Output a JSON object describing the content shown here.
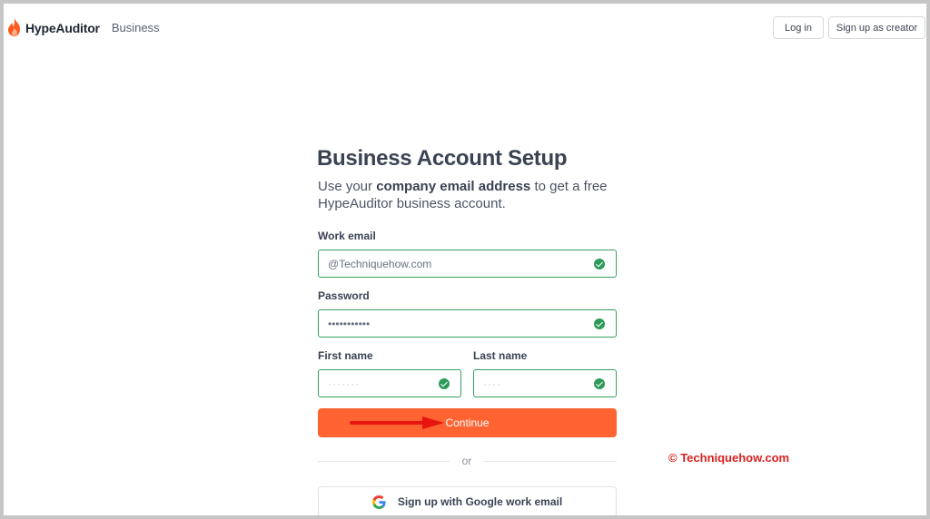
{
  "header": {
    "brand": "HypeAuditor",
    "section": "Business",
    "login_label": "Log in",
    "creator_label": "Sign up as creator"
  },
  "form": {
    "title": "Business Account Setup",
    "intro_before": "Use your ",
    "intro_bold": "company email address",
    "intro_after": " to get a free HypeAuditor business account.",
    "email_label": "Work email",
    "email_value": "@Techniquehow.com",
    "password_label": "Password",
    "password_value": "•••••••••••",
    "first_name_label": "First name",
    "first_name_value": "·······",
    "last_name_label": "Last name",
    "last_name_value": "····",
    "continue_label": "Continue",
    "or_label": "or",
    "google_label": "Sign up with Google work email"
  },
  "watermark": "© Techniquehow.com",
  "colors": {
    "accent": "#ff6332",
    "valid": "#2e9a5a",
    "watermark": "#d91f1f",
    "annotation_arrow": "#e8140f"
  },
  "icons": {
    "logo": "flame-icon",
    "valid": "check-circle-icon",
    "google": "google-g-icon"
  }
}
